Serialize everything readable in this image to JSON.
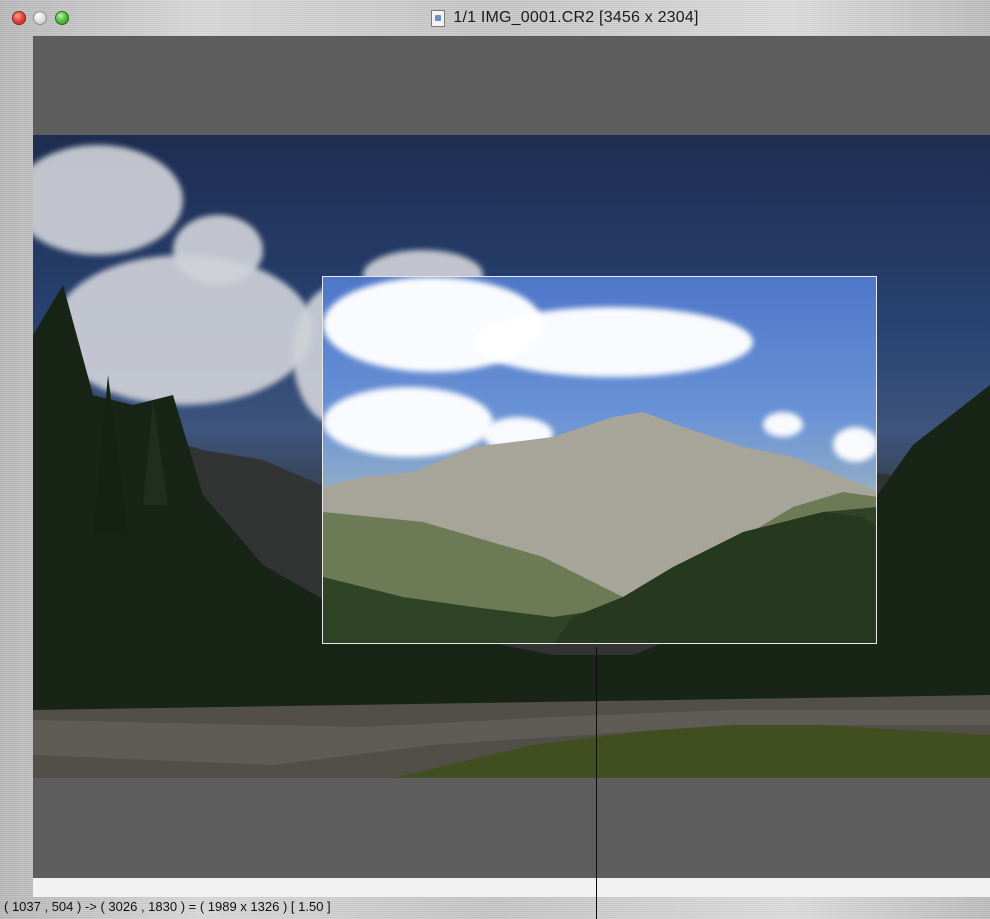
{
  "window": {
    "title": "1/1 IMG_0001.CR2 [3456 x 2304]",
    "controls": [
      "close-button",
      "minimize-button",
      "zoom-button"
    ],
    "icon": "document-icon"
  },
  "viewer": {
    "image_name": "IMG_0001.CR2",
    "image_dimensions": "3456 x 2304",
    "crop_selection": {
      "start": "1037 , 504",
      "end": "3026 , 1830",
      "size": "1989 x 1326",
      "ratio": "1.50"
    }
  },
  "status": {
    "text": "( 1037 , 504 ) -> ( 3026 , 1830 ) = ( 1989 x 1326 ) [ 1.50 ]"
  },
  "colors": {
    "canvas_bg": "#5d5d5d",
    "close": "#e0443a",
    "minimize": "#c8c8c8",
    "zoom": "#4fbf3a",
    "crop_border": "#e8e8e8"
  }
}
